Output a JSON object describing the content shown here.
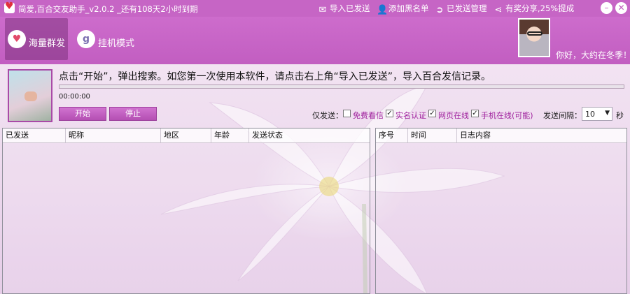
{
  "window": {
    "title": "简爱,百合交友助手_v2.0.2 _还有108天2小时到期",
    "actions": [
      {
        "icon": "envelope-icon",
        "label": "导入已发送"
      },
      {
        "icon": "user-icon",
        "label": "添加黑名单"
      },
      {
        "icon": "arrow-circle-icon",
        "label": "已发送管理"
      },
      {
        "icon": "share-icon",
        "label": "有奖分享,25%提成"
      }
    ]
  },
  "modes": [
    {
      "label": "海量群发",
      "icon": "heart-icon",
      "active": true
    },
    {
      "label": "挂机模式",
      "icon": "g-heart-icon",
      "active": false
    }
  ],
  "user": {
    "greeting": "你好，大约在冬季！"
  },
  "instruction": "点击“开始”，弹出搜索。如您第一次使用本软件，请点击右上角“导入已发送”，导入百合发信记录。",
  "progress": 0,
  "timer": "00:00:00",
  "buttons": {
    "start": "开始",
    "stop": "停止"
  },
  "filter": {
    "label": "仅发送：",
    "options": [
      {
        "label": "免费看信",
        "checked": false
      },
      {
        "label": "实名认证",
        "checked": true
      },
      {
        "label": "网页在线",
        "checked": true
      },
      {
        "label": "手机在线(可能)",
        "checked": true
      }
    ]
  },
  "interval": {
    "label": "发送间隔：",
    "value": "10",
    "unit": "秒"
  },
  "tables": {
    "left": {
      "columns": [
        "已发送",
        "昵称",
        "地区",
        "年龄",
        "发送状态"
      ]
    },
    "right": {
      "columns": [
        "序号",
        "时间",
        "日志内容"
      ]
    }
  },
  "colors": {
    "accent": "#c665c5",
    "option_text": "#a0229e"
  }
}
